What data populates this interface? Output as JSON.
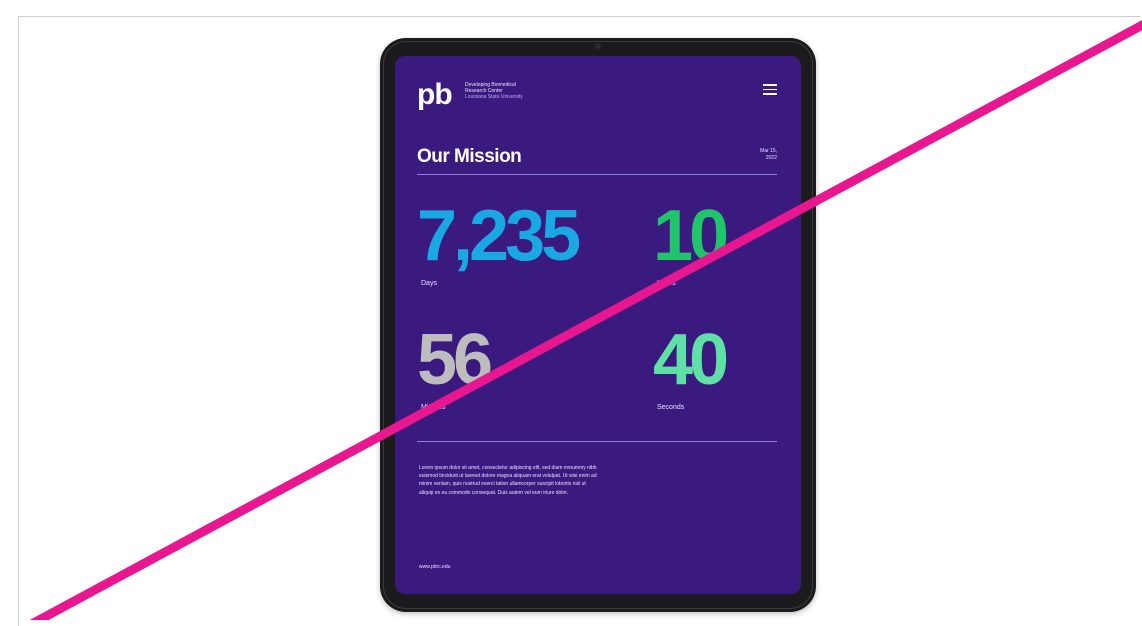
{
  "brand": {
    "logo_text": "pb",
    "org_name_line1": "Developing Biomedical",
    "org_name_line2": "Research Center",
    "org_name_line3": "Louisiana State University"
  },
  "header": {
    "title": "Our Mission",
    "date_line1": "Mar 15,",
    "date_line2": "2022"
  },
  "stats": {
    "days": {
      "value": "7,235",
      "label": "Days"
    },
    "hours": {
      "value": "10",
      "label": "Hours"
    },
    "minutes": {
      "value": "56",
      "label": "Minutes"
    },
    "seconds": {
      "value": "40",
      "label": "Seconds"
    }
  },
  "body": {
    "paragraph": "Lorem ipsum dolor sit amet, consectetur adipiscing elit, sed diam nonummy nibh euismod tincidunt ut laoreet dolore magna aliquam erat volutpat. Ut wisi enim ad minim veniam, quis nostrud exerci tation ullamcorper suscipit lobortis nisl ut aliquip ex ea commodo consequat. Duis autem vel eum iriure dolor."
  },
  "footer": {
    "link": "www.pbrc.edu"
  },
  "colors": {
    "screen_bg": "#3b1a80",
    "days": "#1aa8e3",
    "hours": "#1ec56a",
    "minutes": "#bdbdbd",
    "seconds": "#5fe0a6",
    "strike": "#e8168f"
  }
}
